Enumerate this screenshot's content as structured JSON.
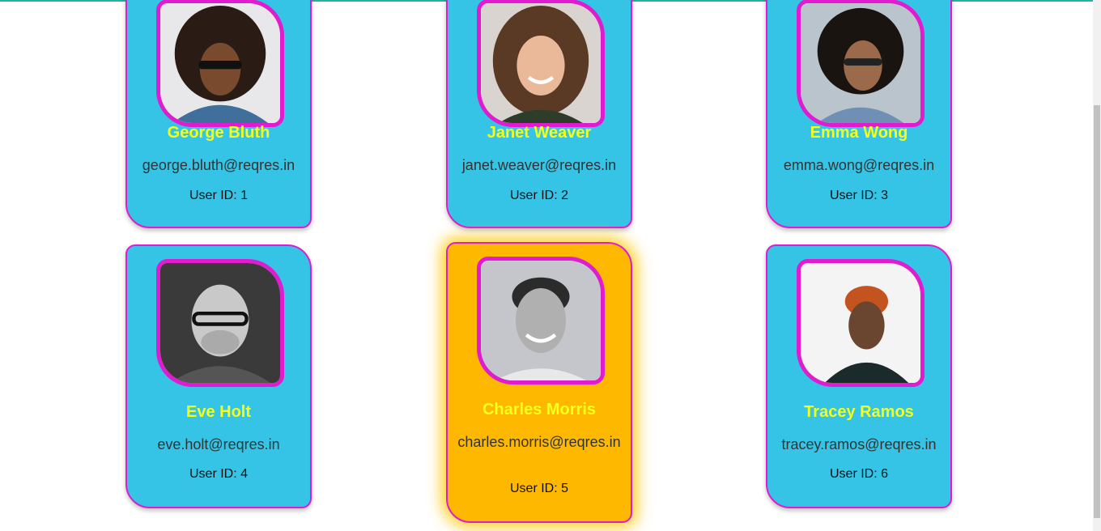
{
  "users": [
    {
      "name": "George Bluth",
      "email": "george.bluth@reqres.in",
      "id_label": "User ID: 1"
    },
    {
      "name": "Janet Weaver",
      "email": "janet.weaver@reqres.in",
      "id_label": "User ID: 2"
    },
    {
      "name": "Emma Wong",
      "email": "emma.wong@reqres.in",
      "id_label": "User ID: 3"
    },
    {
      "name": "Eve Holt",
      "email": "eve.holt@reqres.in",
      "id_label": "User ID: 4"
    },
    {
      "name": "Charles Morris",
      "email": "charles.morris@reqres.in",
      "id_label": "User ID: 5"
    },
    {
      "name": "Tracey Ramos",
      "email": "tracey.ramos@reqres.in",
      "id_label": "User ID: 6"
    }
  ],
  "colors": {
    "card_bg": "#35c4e6",
    "card_featured_bg": "#ffb800",
    "card_border": "#e01bd0",
    "name_color": "#f4ff1a"
  }
}
